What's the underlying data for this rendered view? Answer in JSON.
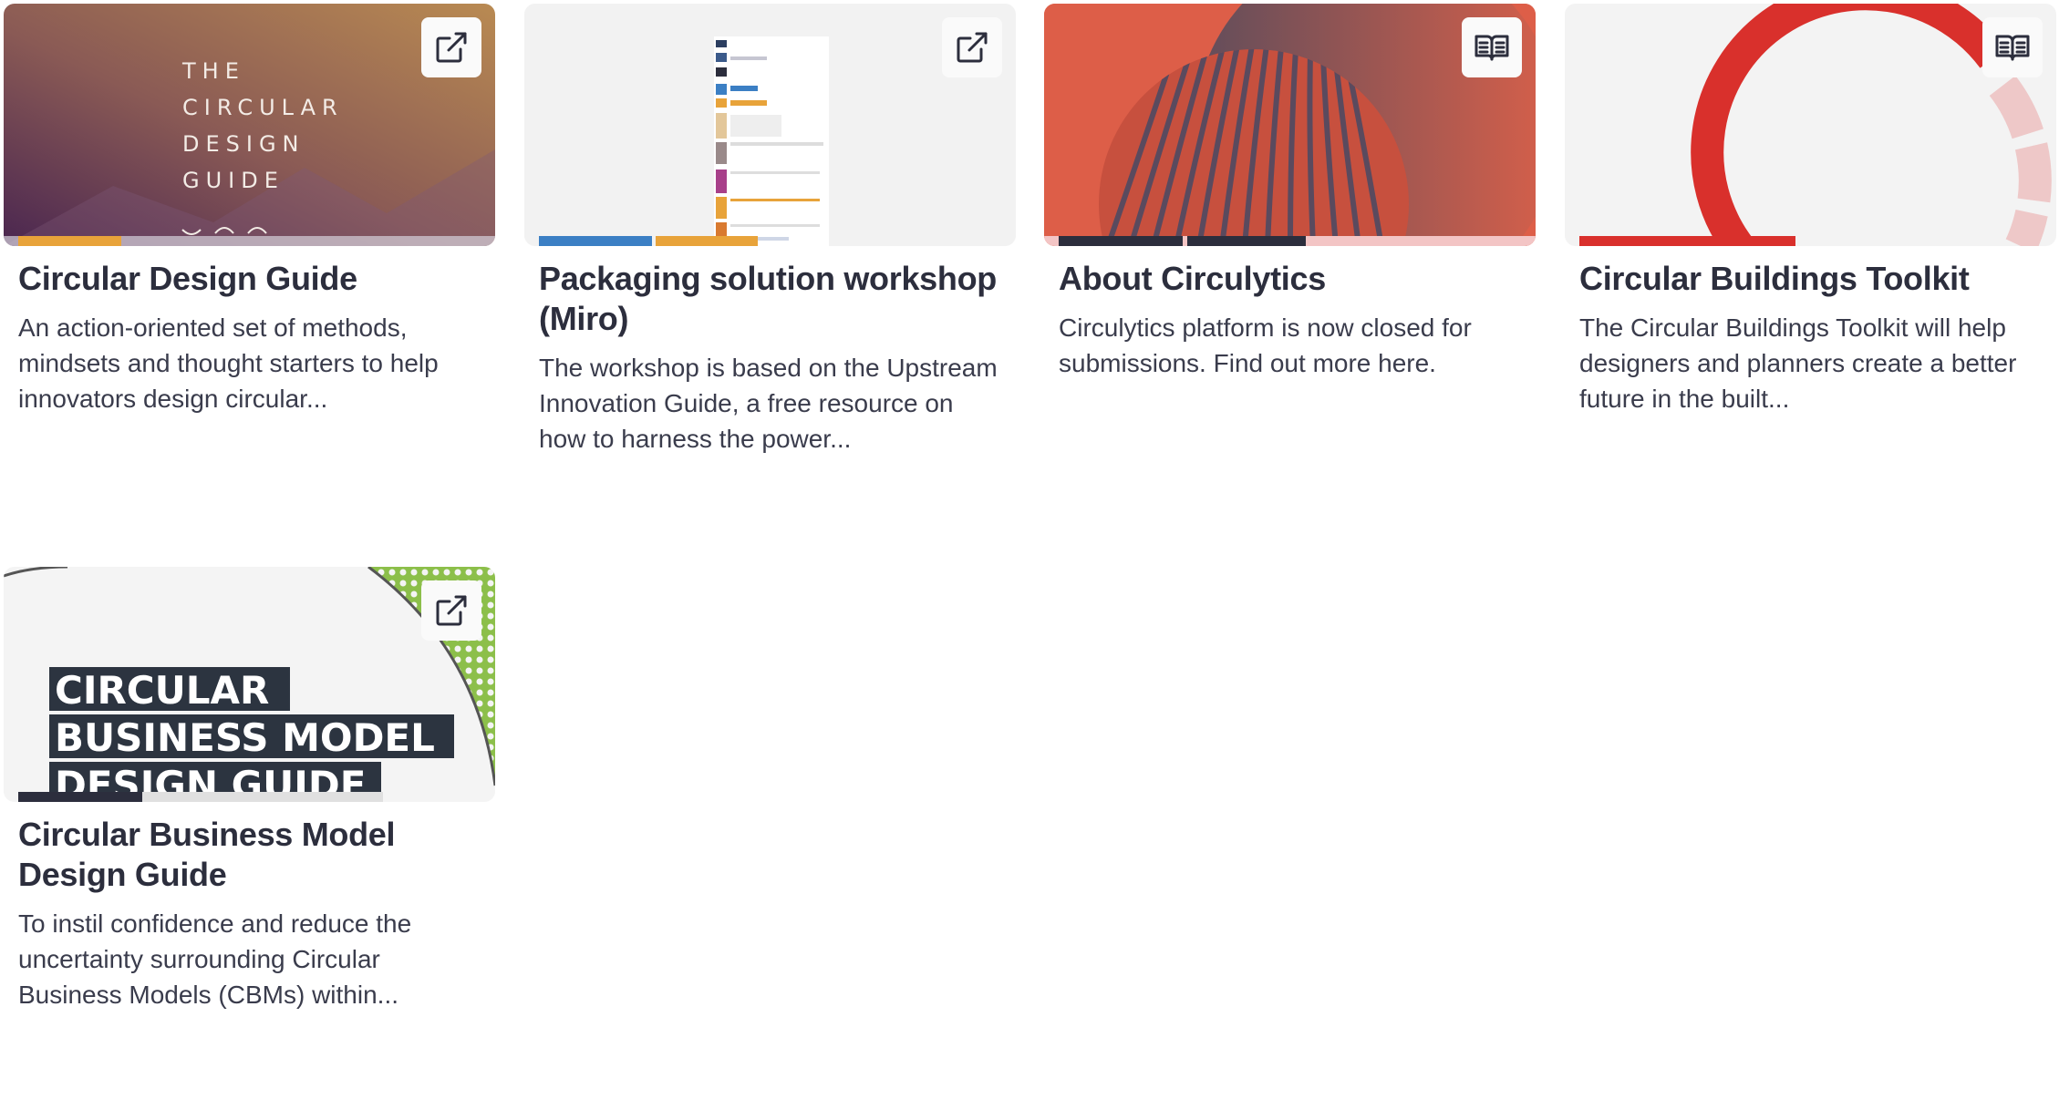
{
  "cards": [
    {
      "title": "Circular Design Guide",
      "description": "An action-oriented set of methods, mindsets and thought starters to help innovators design circular...",
      "corner_icon": "external-link-icon",
      "thumbnail_text": [
        "THE",
        "CIRCULAR",
        "DESIGN",
        "GUIDE"
      ],
      "progress_colors": [
        "#e8a33a",
        "#d6d2dc"
      ]
    },
    {
      "title": "Packaging solution workshop (Miro)",
      "description": "The workshop is based on the Upstream Innovation Guide, a free resource on how to harness the power...",
      "corner_icon": "external-link-icon",
      "progress_colors": [
        "#3b7fc4",
        "#e8a33a",
        "#e8e8e8"
      ]
    },
    {
      "title": "About Circulytics",
      "description": "Circulytics platform is now closed for submissions. Find out more here.",
      "corner_icon": "book-open-icon",
      "progress_colors": [
        "#2c2e3d",
        "#2c2e3d",
        "#f3c5c5"
      ]
    },
    {
      "title": "Circular Buildings Toolkit",
      "description": "The Circular Buildings Toolkit will help designers and planners create a better future in the built...",
      "corner_icon": "book-open-icon",
      "progress_colors": [
        "#d9302c",
        "#eeeeee"
      ]
    },
    {
      "title": "Circular Business Model Design Guide",
      "description": "To instil confidence and reduce the uncertainty surrounding Circular Business Models (CBMs) within...",
      "corner_icon": "external-link-icon",
      "thumbnail_text": [
        "CIRCULAR",
        "BUSINESS MODEL",
        "DESIGN GUIDE"
      ],
      "progress_colors": [
        "#2c2e3d",
        "#e0e0e0"
      ]
    }
  ]
}
